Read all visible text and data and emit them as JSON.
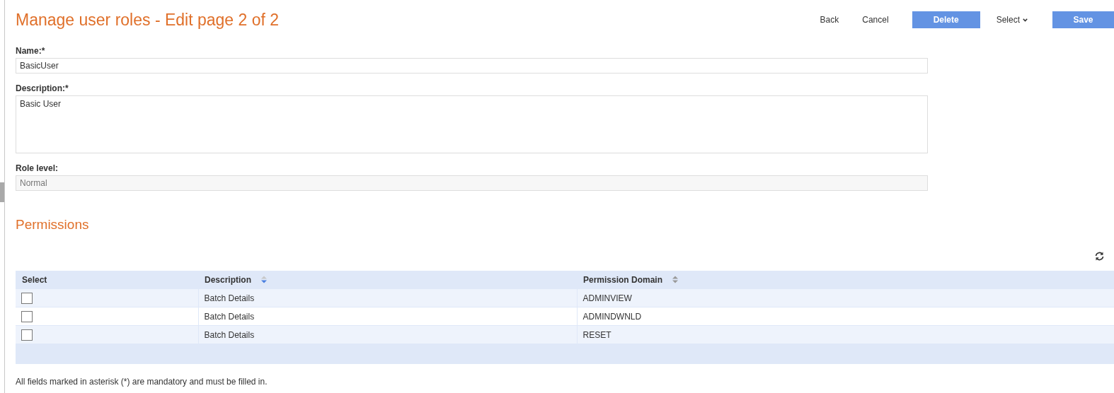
{
  "title": "Manage user roles - Edit page 2 of 2",
  "actions": [
    {
      "label": "Back",
      "kind": "link"
    },
    {
      "label": "Cancel",
      "kind": "link"
    },
    {
      "label": "Delete",
      "kind": "primary"
    },
    {
      "label": "Select",
      "kind": "dropdown"
    },
    {
      "label": "Save",
      "kind": "primary"
    }
  ],
  "fields": [
    {
      "label": "Name:*",
      "value": "BasicUser",
      "kind": "text",
      "disabled": false
    },
    {
      "label": "Description:*",
      "value": "Basic User",
      "kind": "textarea",
      "disabled": false
    },
    {
      "label": "Role level:",
      "value": "Normal",
      "kind": "text",
      "disabled": true
    }
  ],
  "permissions": {
    "heading": "Permissions",
    "columns": [
      {
        "label": "Select",
        "sortable": false
      },
      {
        "label": "Description",
        "sortable": true,
        "sorted": true
      },
      {
        "label": "Permission Domain",
        "sortable": true,
        "sorted": false
      }
    ],
    "rows": [
      {
        "checked": false,
        "description": "Batch Details",
        "domain": "ADMINVIEW"
      },
      {
        "checked": false,
        "description": "Batch Details",
        "domain": "ADMINDWNLD"
      },
      {
        "checked": false,
        "description": "Batch Details",
        "domain": "RESET"
      }
    ]
  },
  "note": "All fields marked in asterisk (*) are mandatory and must be filled in."
}
